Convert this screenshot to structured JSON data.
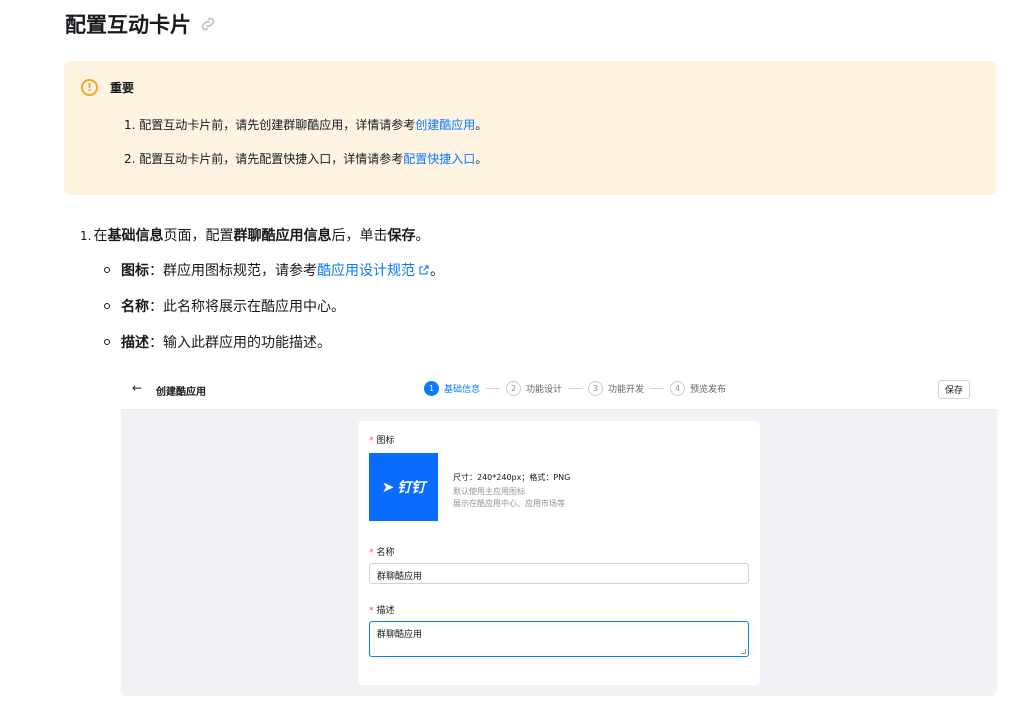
{
  "title": "配置互动卡片",
  "notice": {
    "title": "重要",
    "items": [
      {
        "num": "1.",
        "text": "配置互动卡片前，请先创建群聊酷应用，详情请参考",
        "link": "创建酷应用",
        "end": "。"
      },
      {
        "num": "2.",
        "text": "配置互动卡片前，请先配置快捷入口，详情请参考",
        "link": "配置快捷入口",
        "end": "。"
      }
    ]
  },
  "step1": {
    "num": "1.",
    "parts": [
      "在",
      "基础信息",
      "页面，配置",
      "群聊酷应用信息",
      "后，单击",
      "保存",
      "。"
    ]
  },
  "bullets": [
    {
      "term": "图标",
      "text": "：群应用图标规范，请参考",
      "link": "酷应用设计规范",
      "end": "。"
    },
    {
      "term": "名称",
      "text": "：此名称将展示在酷应用中心。"
    },
    {
      "term": "描述",
      "text": "：输入此群应用的功能描述。"
    }
  ],
  "shot": {
    "back": "←",
    "title": "创建酷应用",
    "steps": [
      {
        "num": "1",
        "label": "基础信息"
      },
      {
        "num": "2",
        "label": "功能设计"
      },
      {
        "num": "3",
        "label": "功能开发"
      },
      {
        "num": "4",
        "label": "预览发布"
      }
    ],
    "save": "保存",
    "form": {
      "icon_label": "图标",
      "logo_text": "钉钉",
      "hint1": "尺寸：240*240px；格式：PNG",
      "hint2": "默认使用主应用图标",
      "hint3": "展示在酷应用中心、应用市场等",
      "name_label": "名称",
      "name_value": "群聊酷应用",
      "desc_label": "描述",
      "desc_value": "群聊酷应用"
    }
  },
  "colors": {
    "accent": "#0a7bff",
    "notice_bg": "#fff3e2",
    "warn": "#f5a623",
    "required": "#f54a45"
  }
}
